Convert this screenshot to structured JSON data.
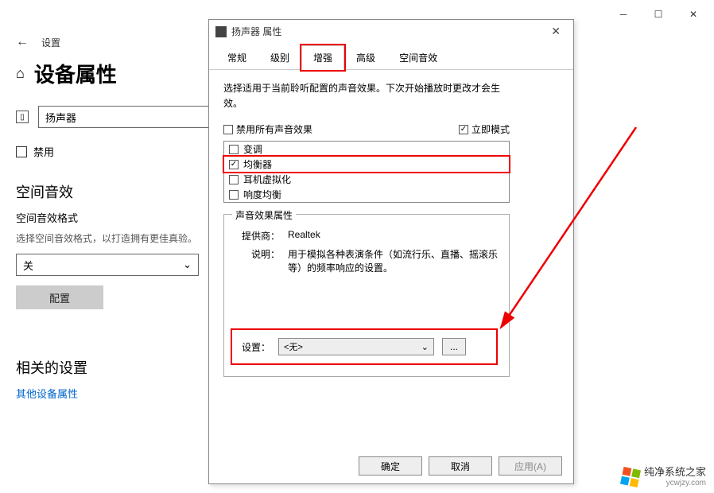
{
  "settings": {
    "back_label": "设置",
    "page_title": "设备属性",
    "device_name": "扬声器",
    "disable_label": "禁用",
    "spatial_heading": "空间音效",
    "spatial_format_label": "空间音效格式",
    "spatial_desc": "选择空间音效格式，以打造拥有更佳真验。",
    "format_value": "关",
    "config_button": "配置",
    "related_heading": "相关的设置",
    "other_link": "其他设备属性"
  },
  "dialog": {
    "title": "扬声器 属性",
    "tabs": [
      "常规",
      "级别",
      "增强",
      "高级",
      "空间音效"
    ],
    "active_tab_index": 2,
    "description": "选择适用于当前聆听配置的声音效果。下次开始播放时更改才会生效。",
    "disable_all_label": "禁用所有声音效果",
    "disable_all_checked": false,
    "immediate_label": "立即模式",
    "immediate_checked": true,
    "effects": [
      {
        "label": "变调",
        "checked": false
      },
      {
        "label": "均衡器",
        "checked": true
      },
      {
        "label": "耳机虚拟化",
        "checked": false
      },
      {
        "label": "响度均衡",
        "checked": false
      }
    ],
    "properties": {
      "legend": "声音效果属性",
      "provider_label": "提供商：",
      "provider_value": "Realtek",
      "desc_label": "说明：",
      "desc_value": "用于模拟各种表演条件（如流行乐、直播、摇滚乐等）的频率响应的设置。"
    },
    "setting_label": "设置：",
    "setting_value": "<无>",
    "browse_label": "...",
    "buttons": {
      "ok": "确定",
      "cancel": "取消",
      "apply": "应用(A)"
    }
  },
  "watermark": {
    "text": "纯净系统之家",
    "url": "ycwjzy.com"
  }
}
